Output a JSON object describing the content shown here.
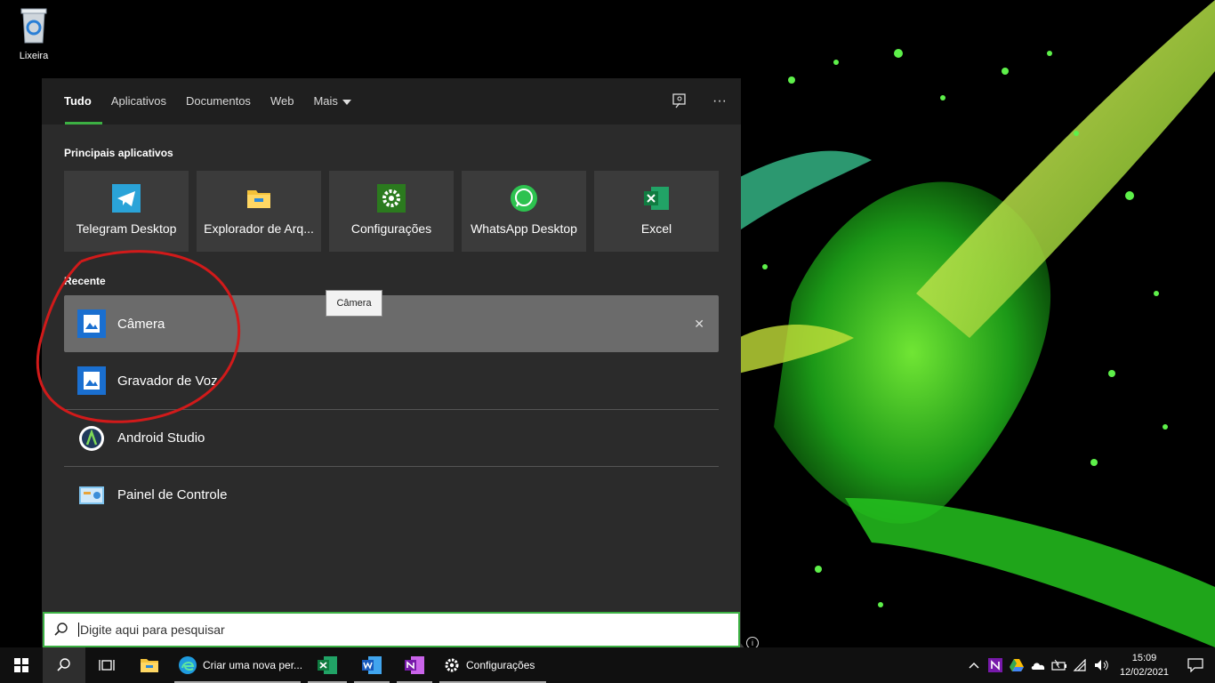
{
  "desktop": {
    "recycle_bin_label": "Lixeira"
  },
  "tabs": [
    {
      "label": "Tudo"
    },
    {
      "label": "Aplicativos"
    },
    {
      "label": "Documentos"
    },
    {
      "label": "Web"
    },
    {
      "label": "Mais"
    }
  ],
  "header_icons": [
    "feedback-icon",
    "more-options-icon"
  ],
  "more_glyph": "···",
  "top_apps": {
    "title": "Principais aplicativos",
    "items": [
      {
        "label": "Telegram Desktop",
        "icon": "telegram-icon"
      },
      {
        "label": "Explorador de Arq...",
        "icon": "file-explorer-icon"
      },
      {
        "label": "Configurações",
        "icon": "settings-icon"
      },
      {
        "label": "WhatsApp Desktop",
        "icon": "whatsapp-icon"
      },
      {
        "label": "Excel",
        "icon": "excel-icon"
      }
    ]
  },
  "recent": {
    "title": "Recente",
    "items": [
      {
        "label": "Câmera",
        "icon": "camera-app-icon",
        "selected": true
      },
      {
        "label": "Gravador de Voz",
        "icon": "voice-recorder-icon"
      },
      {
        "label": "Android Studio",
        "icon": "android-studio-icon"
      },
      {
        "label": "Painel de Controle",
        "icon": "control-panel-icon"
      }
    ],
    "remove_glyph": "✕"
  },
  "tooltip": "Câmera",
  "info_glyph": "i",
  "search": {
    "placeholder": "Digite aqui para pesquisar"
  },
  "taskbar": {
    "edge_label": "Criar uma nova per...",
    "settings_label": "Configurações",
    "clock_time": "15:09",
    "clock_date": "12/02/2021"
  },
  "colors": {
    "accent": "#3cb043",
    "panel": "#2b2b2b",
    "tile": "#3b3b3b",
    "selected": "#6b6b6b"
  }
}
